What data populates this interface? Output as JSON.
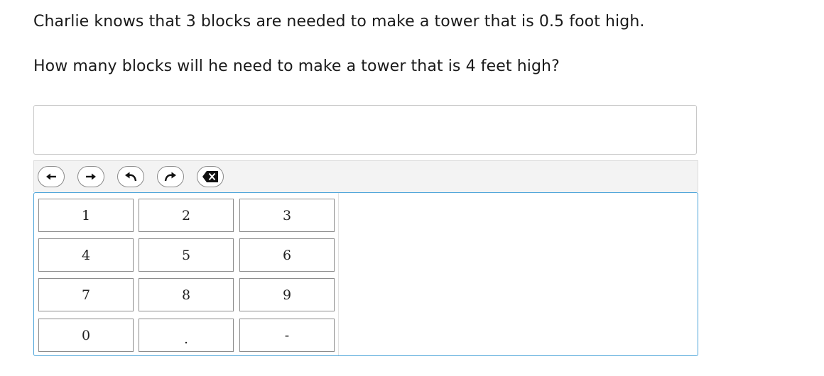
{
  "question": {
    "line1": "Charlie knows that 3 blocks are needed to make a tower that is 0.5 foot high.",
    "line2": "How many blocks will he need to make a tower that is 4 feet high?"
  },
  "answer": {
    "value": ""
  },
  "toolbar": {
    "buttons": [
      {
        "name": "cursor-left",
        "icon": "arrow-left-icon"
      },
      {
        "name": "cursor-right",
        "icon": "arrow-right-icon"
      },
      {
        "name": "undo",
        "icon": "undo-icon"
      },
      {
        "name": "redo",
        "icon": "redo-icon"
      },
      {
        "name": "backspace",
        "icon": "backspace-icon"
      }
    ]
  },
  "keypad": {
    "keys": [
      [
        "1",
        "2",
        "3"
      ],
      [
        "4",
        "5",
        "6"
      ],
      [
        "7",
        "8",
        "9"
      ],
      [
        "0",
        ".",
        "-"
      ]
    ]
  },
  "colors": {
    "keypad_border": "#4aa3d9",
    "toolbar_bg": "#f3f3f3",
    "text": "#1a1a1a"
  }
}
